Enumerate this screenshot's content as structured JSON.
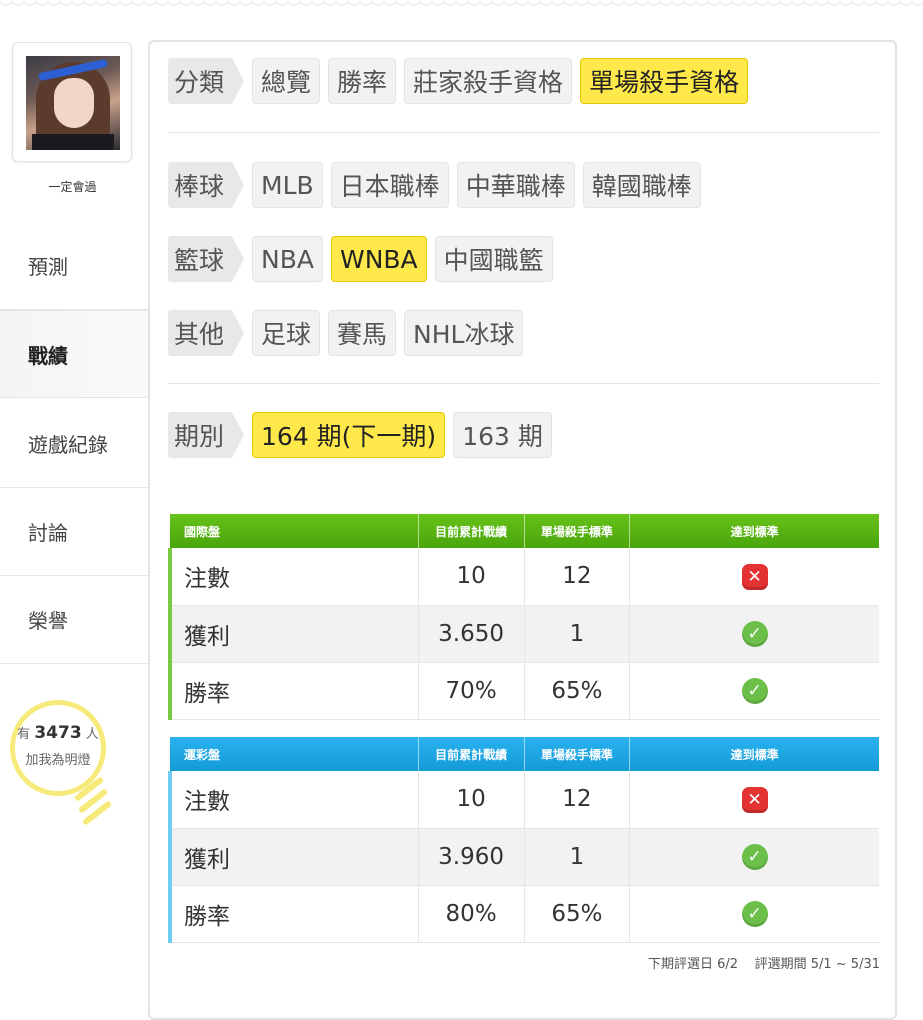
{
  "sidebar": {
    "username": "一定會過",
    "nav": [
      "預測",
      "戰績",
      "遊戲紀錄",
      "討論",
      "榮譽"
    ],
    "active_nav": "戰績",
    "bulb": {
      "prefix": "有",
      "count": "3473",
      "suffix": "人",
      "line2": "加我為明燈"
    }
  },
  "filters": {
    "category": {
      "label": "分類",
      "options": [
        "總覽",
        "勝率",
        "莊家殺手資格",
        "單場殺手資格"
      ],
      "selected": "單場殺手資格"
    },
    "baseball": {
      "label": "棒球",
      "options": [
        "MLB",
        "日本職棒",
        "中華職棒",
        "韓國職棒"
      ]
    },
    "basketball": {
      "label": "籃球",
      "options": [
        "NBA",
        "WNBA",
        "中國職籃"
      ],
      "selected": "WNBA"
    },
    "other": {
      "label": "其他",
      "options": [
        "足球",
        "賽馬",
        "NHL冰球"
      ]
    },
    "period": {
      "label": "期別",
      "options": [
        "164 期(下一期)",
        "163 期"
      ],
      "selected": "164 期(下一期)"
    }
  },
  "tables": [
    {
      "headers": [
        "國際盤",
        "目前累計戰績",
        "單場殺手標準",
        "達到標準"
      ],
      "rows": [
        {
          "name": "注數",
          "current": "10",
          "standard": "12",
          "met": false
        },
        {
          "name": "獲利",
          "current": "3.650",
          "standard": "1",
          "met": true
        },
        {
          "name": "勝率",
          "current": "70%",
          "standard": "65%",
          "met": true
        }
      ]
    },
    {
      "headers": [
        "運彩盤",
        "目前累計戰績",
        "單場殺手標準",
        "達到標準"
      ],
      "rows": [
        {
          "name": "注數",
          "current": "10",
          "standard": "12",
          "met": false
        },
        {
          "name": "獲利",
          "current": "3.960",
          "standard": "1",
          "met": true
        },
        {
          "name": "勝率",
          "current": "80%",
          "standard": "65%",
          "met": true
        }
      ]
    }
  ],
  "footer": {
    "next_eval": "下期評選日 6/2",
    "eval_period": "評選期間 5/1 ~ 5/31"
  },
  "colors": {
    "selected": "#ffe94a",
    "green_header": "#5bb514",
    "blue_header": "#1fa7e3",
    "fail": "#e23232",
    "pass": "#6cc04a"
  },
  "icons": {
    "fail": "x-icon",
    "pass": "check-icon"
  }
}
